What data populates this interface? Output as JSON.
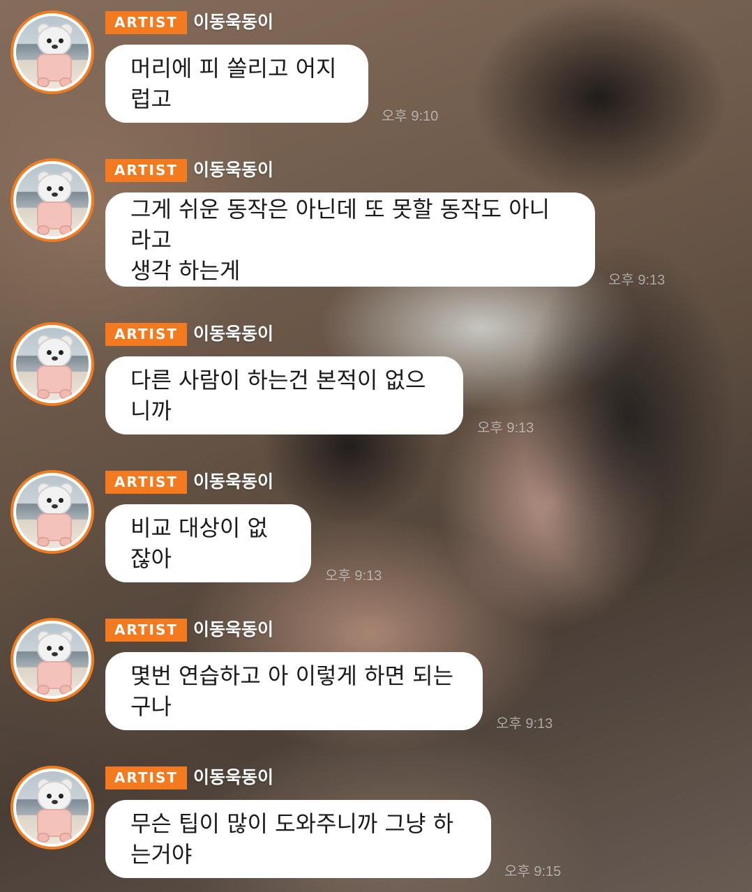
{
  "chat": {
    "messages": [
      {
        "badge": "ARTIST",
        "sender": "이동욱동이",
        "text": "머리에 피 쏠리고 어지럽고",
        "time": "오후 9:10"
      },
      {
        "badge": "ARTIST",
        "sender": "이동욱동이",
        "text": "그게 쉬운 동작은 아닌데 또 못할 동작도 아니라고\n생각 하는게",
        "time": "오후 9:13"
      },
      {
        "badge": "ARTIST",
        "sender": "이동욱동이",
        "text": "다른 사람이 하는건 본적이 없으니까",
        "time": "오후 9:13"
      },
      {
        "badge": "ARTIST",
        "sender": "이동욱동이",
        "text": "비교 대상이 없잖아",
        "time": "오후 9:13"
      },
      {
        "badge": "ARTIST",
        "sender": "이동욱동이",
        "text": "몇번 연습하고 아 이렇게 하면 되는구나",
        "time": "오후 9:13"
      },
      {
        "badge": "ARTIST",
        "sender": "이동욱동이",
        "text": "무슨 팁이 많이 도와주니까 그냥 하는거야",
        "time": "오후 9:15"
      }
    ]
  },
  "colors": {
    "badge": "#f47a20",
    "avatar_ring": "#f07d22",
    "bubble": "#ffffff"
  },
  "icons": {
    "avatar": "bear-avatar-icon"
  }
}
